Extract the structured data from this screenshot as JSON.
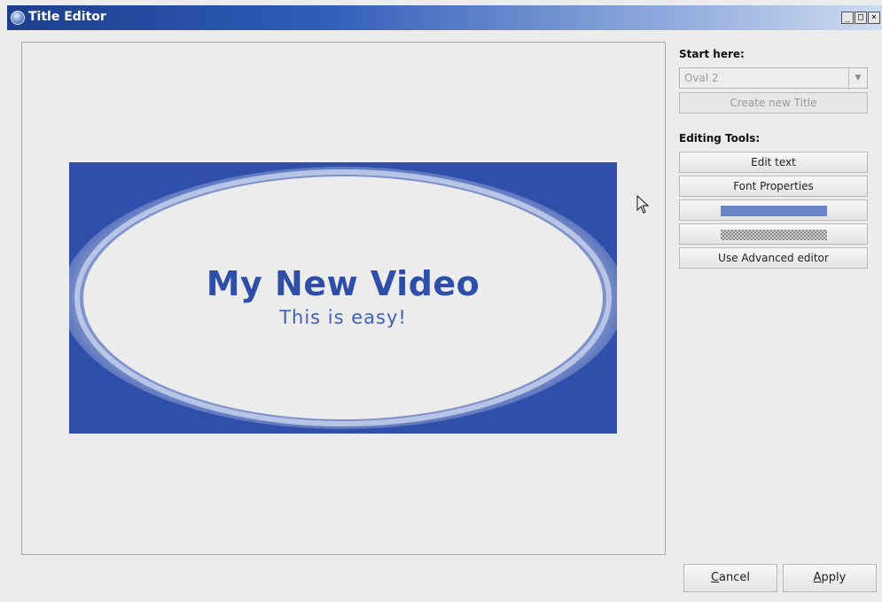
{
  "window": {
    "title": "Title Editor",
    "controls": {
      "minimize": "_",
      "maximize": "□",
      "close": "×"
    }
  },
  "preview": {
    "title_text": "My New Video",
    "subtitle_text": "This is easy!",
    "colors": {
      "background": "#2f4fab",
      "oval": "#ececec",
      "text": "#2e4ea8"
    }
  },
  "sidebar": {
    "start_label": "Start here:",
    "template_select": {
      "value": "Oval 2"
    },
    "create_button": "Create new Title",
    "editing_label": "Editing Tools:",
    "edit_text_button": "Edit text",
    "font_properties_button": "Font Properties",
    "color_swatch": "#6a84c8",
    "advanced_button": "Use Advanced editor"
  },
  "footer": {
    "cancel_mnemonic": "C",
    "cancel_rest": "ancel",
    "apply_mnemonic": "A",
    "apply_rest": "pply"
  }
}
